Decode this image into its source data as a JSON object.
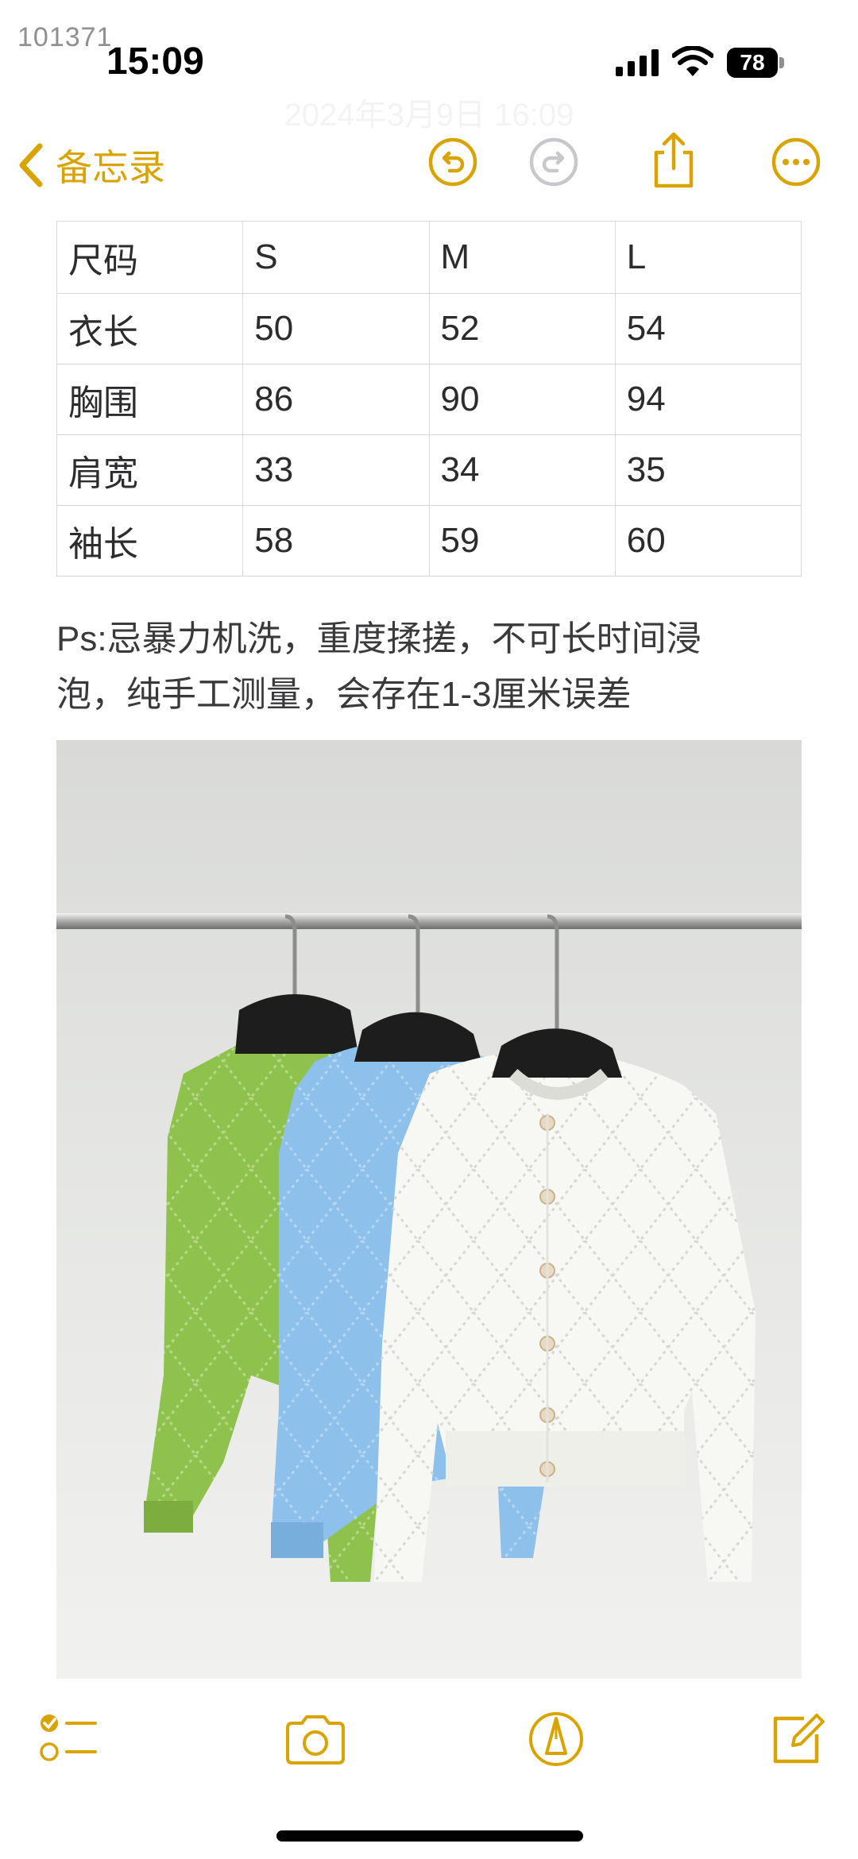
{
  "status": {
    "watermark": "101371",
    "time": "15:09",
    "battery": "78",
    "battery_level": 0.78
  },
  "header": {
    "faded_date": "2024年3月9日 16:09",
    "back_label": "备忘录"
  },
  "size_table": {
    "rows": [
      [
        "尺码",
        "S",
        "M",
        "L"
      ],
      [
        "衣长",
        "50",
        "52",
        "54"
      ],
      [
        "胸围",
        "86",
        "90",
        "94"
      ],
      [
        "肩宽",
        "33",
        "34",
        "35"
      ],
      [
        "袖长",
        "58",
        "59",
        "60"
      ]
    ]
  },
  "note": {
    "line1": "Ps:忌暴力机洗，重度揉搓，不可长时间浸",
    "line2": "泡，纯手工测量，会存在1-3厘米误差"
  },
  "photo": {
    "garments": [
      "green-cardigan",
      "blue-cardigan",
      "white-cardigan"
    ]
  },
  "colors": {
    "accent": "#d9a400",
    "disabled": "#c7c7cc",
    "green_knit": "#8fc24c",
    "blue_knit": "#8dc0ea",
    "white_knit": "#f7f7f4"
  }
}
